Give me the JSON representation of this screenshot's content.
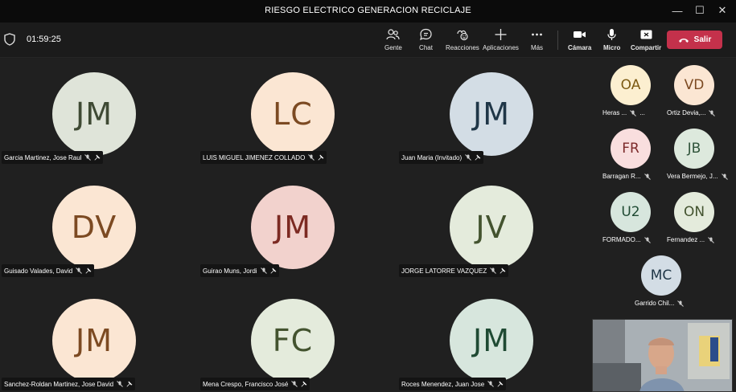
{
  "window": {
    "title": "RIESGO ELECTRICO GENERACION RECICLAJE",
    "min_icon": "minimize-icon",
    "max_icon": "maximize-icon",
    "close_icon": "close-icon"
  },
  "toolbar": {
    "timer": "01:59:25",
    "people": "Gente",
    "chat": "Chat",
    "reactions": "Reacciones",
    "apps": "Aplicaciones",
    "more": "Más",
    "camera": "Cámara",
    "mic": "Micro",
    "share": "Compartir",
    "leave": "Salir",
    "leave_color": "#c4314b"
  },
  "grid": [
    {
      "initials": "JM",
      "name": "Garcia Martinez, Jose Raul",
      "bg": "#dfe4d9",
      "fg": "#3f4a34"
    },
    {
      "initials": "LC",
      "name": "LUIS MIGUEL JIMENEZ COLLADO",
      "bg": "#fbe6d3",
      "fg": "#7c4a22"
    },
    {
      "initials": "JM",
      "name": "Juan Maria (Invitado)",
      "bg": "#d3dde5",
      "fg": "#1f3647"
    },
    {
      "initials": "DV",
      "name": "Guisado Valades, David",
      "bg": "#fbe6d3",
      "fg": "#7c4a22"
    },
    {
      "initials": "JM",
      "name": "Guirao Muns, Jordi",
      "bg": "#f2d2cd",
      "fg": "#7c2a22"
    },
    {
      "initials": "JV",
      "name": "JORGE LATORRE VAZQUEZ",
      "bg": "#e4ebdc",
      "fg": "#43532f"
    },
    {
      "initials": "JM",
      "name": "Sanchez-Roldan Martinez, Jose David",
      "bg": "#fbe6d3",
      "fg": "#7c4a22"
    },
    {
      "initials": "FC",
      "name": "Mena Crespo, Francisco José",
      "bg": "#e4ebdc",
      "fg": "#43532f"
    },
    {
      "initials": "JM",
      "name": "Roces Menendez, Juan Jose",
      "bg": "#d7e6dd",
      "fg": "#1f4a33"
    }
  ],
  "side": [
    {
      "initials": "OA",
      "name": "Heras ...",
      "bg": "#fcefd0",
      "fg": "#7c5a12",
      "more": "..."
    },
    {
      "initials": "VD",
      "name": "Ortiz Devia,...",
      "bg": "#fbe6d3",
      "fg": "#7c4a22"
    },
    {
      "initials": "FR",
      "name": "Barragan R...",
      "bg": "#f9dede",
      "fg": "#7c2a2a"
    },
    {
      "initials": "JB",
      "name": "Vera Bermejo, J...",
      "bg": "#dde9dd",
      "fg": "#2f533a"
    },
    {
      "initials": "U2",
      "name": "FORMADO...",
      "bg": "#d7e6dd",
      "fg": "#1f4a33"
    },
    {
      "initials": "ON",
      "name": "Fernandez ...",
      "bg": "#e4ebdc",
      "fg": "#43532f"
    },
    {
      "initials": "MC",
      "name": "Garrido Chil...",
      "bg": "#d3dde5",
      "fg": "#1f3647"
    }
  ]
}
